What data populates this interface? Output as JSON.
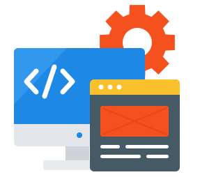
{
  "illustration": {
    "subject": "web-development-icon",
    "colors": {
      "gear": "#F4511E",
      "monitor_screen": "#1E88E5",
      "monitor_screen_highlight": "#42A5F5",
      "monitor_chin": "#E3E6EA",
      "monitor_stand": "#CFD3D8",
      "monitor_base": "#E8EBEE",
      "code_symbol": "#FFFFFF",
      "browser_header": "#FBC02D",
      "browser_body": "#455A64",
      "browser_dots": "#FFFFFF",
      "browser_banner": "#F4511E",
      "browser_banner_lines": "#E64A19",
      "browser_text_lines": "#FFFFFF",
      "camera_dot": "#1E88E5"
    },
    "icons": [
      "gear-icon",
      "monitor-icon",
      "code-icon",
      "browser-window-icon"
    ]
  }
}
